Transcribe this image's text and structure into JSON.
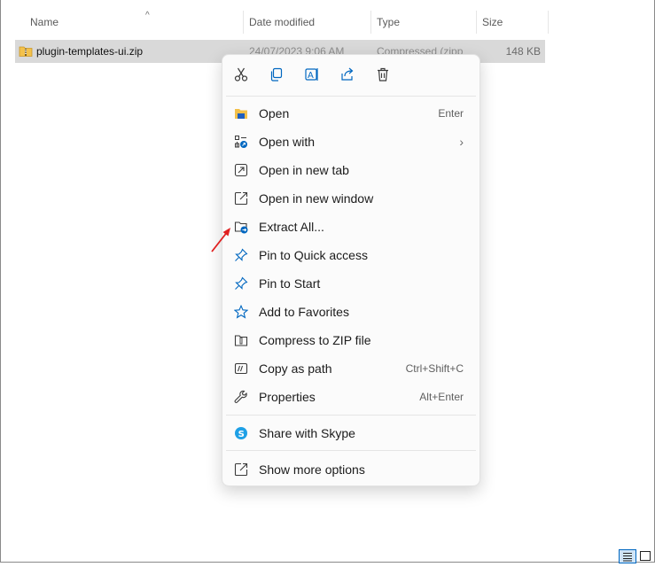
{
  "columns": {
    "name": "Name",
    "date": "Date modified",
    "type": "Type",
    "size": "Size"
  },
  "file": {
    "name": "plugin-templates-ui.zip",
    "date": "24/07/2023 9:06 AM",
    "type": "Compressed (zipp",
    "size": "148 KB"
  },
  "toolbar": [
    "cut-icon",
    "copy-icon",
    "rename-icon",
    "share-icon",
    "delete-icon"
  ],
  "menu": {
    "items": [
      {
        "label": "Open",
        "shortcut": "Enter",
        "icon": "folder-open-icon"
      },
      {
        "label": "Open with",
        "shortcut": "",
        "icon": "open-with-icon",
        "submenu": "›"
      },
      {
        "label": "Open in new tab",
        "shortcut": "",
        "icon": "new-tab-icon"
      },
      {
        "label": "Open in new window",
        "shortcut": "",
        "icon": "new-window-icon"
      },
      {
        "label": "Extract All...",
        "shortcut": "",
        "icon": "extract-icon"
      },
      {
        "label": "Pin to Quick access",
        "shortcut": "",
        "icon": "pin-icon"
      },
      {
        "label": "Pin to Start",
        "shortcut": "",
        "icon": "pin-start-icon"
      },
      {
        "label": "Add to Favorites",
        "shortcut": "",
        "icon": "star-icon"
      },
      {
        "label": "Compress to ZIP file",
        "shortcut": "",
        "icon": "compress-icon"
      },
      {
        "label": "Copy as path",
        "shortcut": "Ctrl+Shift+C",
        "icon": "copy-path-icon"
      },
      {
        "label": "Properties",
        "shortcut": "Alt+Enter",
        "icon": "wrench-icon"
      }
    ],
    "share": {
      "label": "Share with Skype",
      "icon": "skype-icon"
    },
    "more": {
      "label": "Show more options",
      "icon": "more-options-icon"
    }
  },
  "colors": {
    "accent": "#0067c0",
    "selection": "#d9d9d9",
    "annotation": "#e02020",
    "folder": "#f3c14b"
  }
}
